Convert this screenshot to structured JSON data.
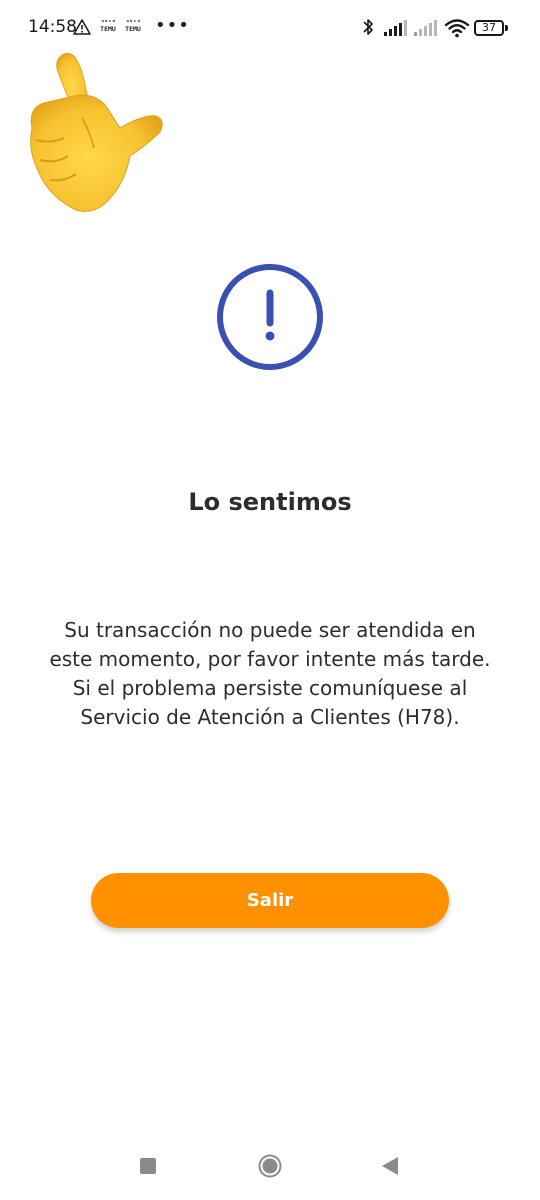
{
  "status_bar": {
    "time": "14:58",
    "notification_icons": [
      "warning-icon",
      "temu-notification",
      "temu-notification"
    ],
    "temu_badges": [
      {
        "top": "ᵃᵇᶜᵈ",
        "bottom": "TEMU"
      },
      {
        "top": "ᵃᵇᶜᵈ",
        "bottom": "TEMU"
      }
    ],
    "more": "•••",
    "battery_level": "37",
    "right_icons": [
      "bluetooth-icon",
      "cell-signal-icon",
      "cell-signal-icon",
      "wifi-icon",
      "battery-icon"
    ]
  },
  "overlay": {
    "icon": "pointing-up-left-hand-emoji",
    "color": "#F5C52E"
  },
  "alert": {
    "icon": "exclamation-circle-icon",
    "color": "#3B50B0"
  },
  "title": "Lo sentimos",
  "message_lines": [
    "Su transacción no puede ser atendida en",
    "este momento, por favor intente más tarde.",
    "Si el problema persiste comuníquese al",
    "Servicio de Atención a Clientes  (H78)."
  ],
  "exit_button": {
    "label": "Salir",
    "color": "#FF9000"
  },
  "nav_bar": {
    "icons": [
      "recents-icon",
      "home-icon",
      "back-icon"
    ]
  }
}
